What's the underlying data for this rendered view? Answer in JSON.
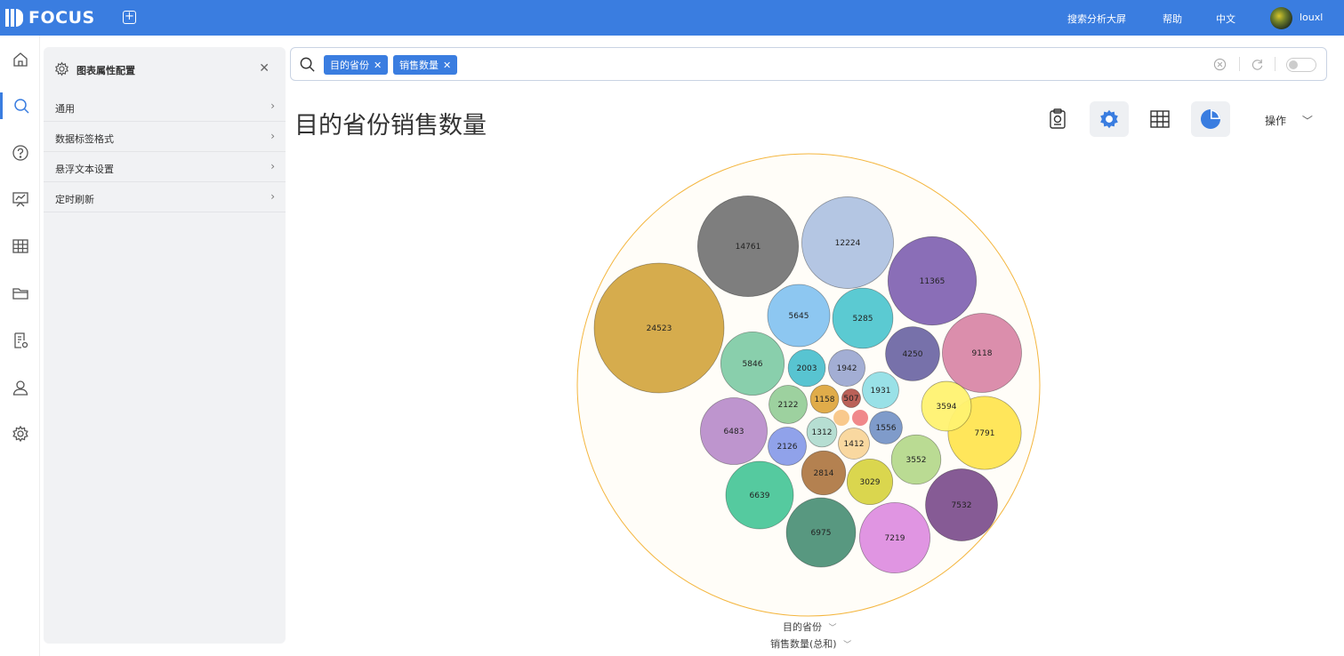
{
  "app": {
    "logo_text": "FOCUS",
    "accent_color": "#3a7de0"
  },
  "header": {
    "links": [
      "搜索分析大屏",
      "帮助",
      "中文"
    ],
    "user_name": "louxl"
  },
  "rail": {
    "icons": [
      "home-icon",
      "search-icon",
      "help-icon",
      "dashboard-icon",
      "table-icon",
      "folder-icon",
      "report-settings-icon",
      "user-icon",
      "settings-icon"
    ],
    "active_index": 1
  },
  "panel": {
    "title": "图表属性配置",
    "rows": [
      "通用",
      "数据标签格式",
      "悬浮文本设置",
      "定时刷新"
    ]
  },
  "search": {
    "chips": [
      "目的省份",
      "销售数量"
    ]
  },
  "chart_title": "目的省份销售数量",
  "toolbar": {
    "ops_label": "操作"
  },
  "axis": {
    "group_label": "目的省份",
    "value_label": "销售数量(总和)"
  },
  "chart_data": {
    "type": "packed-bubble",
    "values": [
      24523,
      14761,
      12224,
      11365,
      9118,
      7791,
      7532,
      7219,
      6975,
      6639,
      6483,
      5846,
      5645,
      5285,
      4250,
      3594,
      3552,
      3029,
      2814,
      2126,
      2122,
      2003,
      1942,
      1931,
      1556,
      1412,
      1312,
      1158,
      507
    ],
    "unlabeled_small_bubbles": 2,
    "colors": [
      "#d4a843",
      "#777777",
      "#b0c3e2",
      "#8466b3",
      "#d988a8",
      "#ffe552",
      "#7f528f",
      "#de8fe0",
      "#4f9279",
      "#4cc79a",
      "#bb8fcb",
      "#83cca8",
      "#87c4f0",
      "#52c7d0",
      "#7069a5",
      "#fff271",
      "#b6d98d",
      "#d8d445",
      "#b07a47",
      "#8a9de9",
      "#98cf9a",
      "#4fc1cf",
      "#9eaad2",
      "#93dfe6",
      "#7896c7",
      "#f9d69b",
      "#b2dcd0",
      "#dea840",
      "#b6584f"
    ],
    "outer_circle_color": "#f4b63f"
  }
}
